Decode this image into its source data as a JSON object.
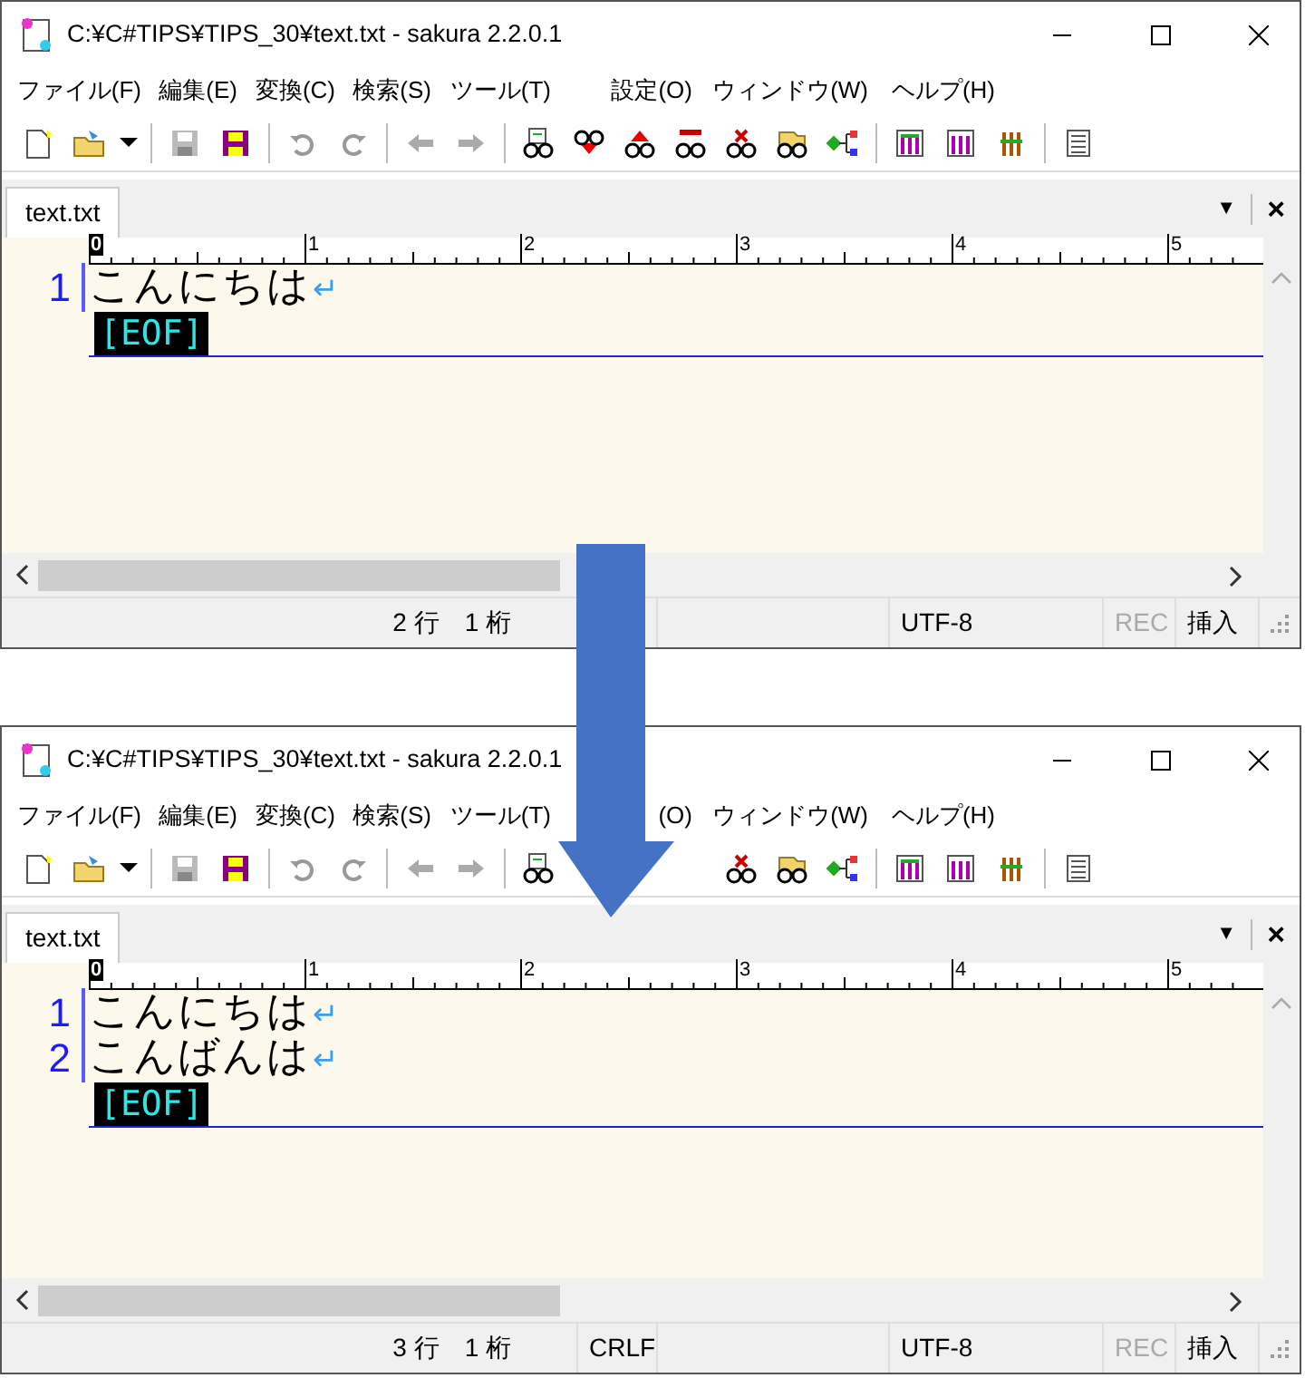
{
  "windows": [
    {
      "title": "C:¥C#TIPS¥TIPS_30¥text.txt - sakura 2.2.0.1",
      "menu": [
        "ファイル(F)",
        "編集(E)",
        "変換(C)",
        "検索(S)",
        "ツール(T)",
        "設定(O)",
        "ウィンドウ(W)",
        "ヘルプ(H)"
      ],
      "tabs": [
        {
          "label": "text.txt",
          "selected": true
        }
      ],
      "tab_menu": "▼",
      "tab_close": "×",
      "ruler_marks": [
        "0",
        "1",
        "2",
        "3",
        "4",
        "5"
      ],
      "lines": [
        {
          "number": "1",
          "text": "こんにちは",
          "eol": "↵"
        }
      ],
      "eof": "[EOF]",
      "status_bar": {
        "position": "2 行　1 桁",
        "encoding": "UTF-8",
        "rec": {
          "text": "REC",
          "disabled": true
        },
        "mode": "挿入"
      }
    },
    {
      "title": "C:¥C#TIPS¥TIPS_30¥text.txt - sakura 2.2.0.1",
      "menu": [
        "ファイル(F)",
        "編集(E)",
        "変換(C)",
        "検索(S)",
        "ツール(T)",
        "(O)",
        "ウィンドウ(W)",
        "ヘルプ(H)"
      ],
      "tabs": [
        {
          "label": "text.txt",
          "selected": true
        }
      ],
      "tab_menu": "▼",
      "tab_close": "×",
      "ruler_marks": [
        "0",
        "1",
        "2",
        "3",
        "4",
        "5"
      ],
      "lines": [
        {
          "number": "1",
          "text": "こんにちは",
          "eol": "↵"
        },
        {
          "number": "2",
          "text": "こんばんは",
          "eol": "↵"
        }
      ],
      "eof": "[EOF]",
      "status_bar": {
        "position": "3 行　1 桁",
        "line_ending": "CRLF",
        "encoding": "UTF-8",
        "rec": {
          "text": "REC",
          "disabled": true
        },
        "mode": "挿入"
      }
    }
  ]
}
